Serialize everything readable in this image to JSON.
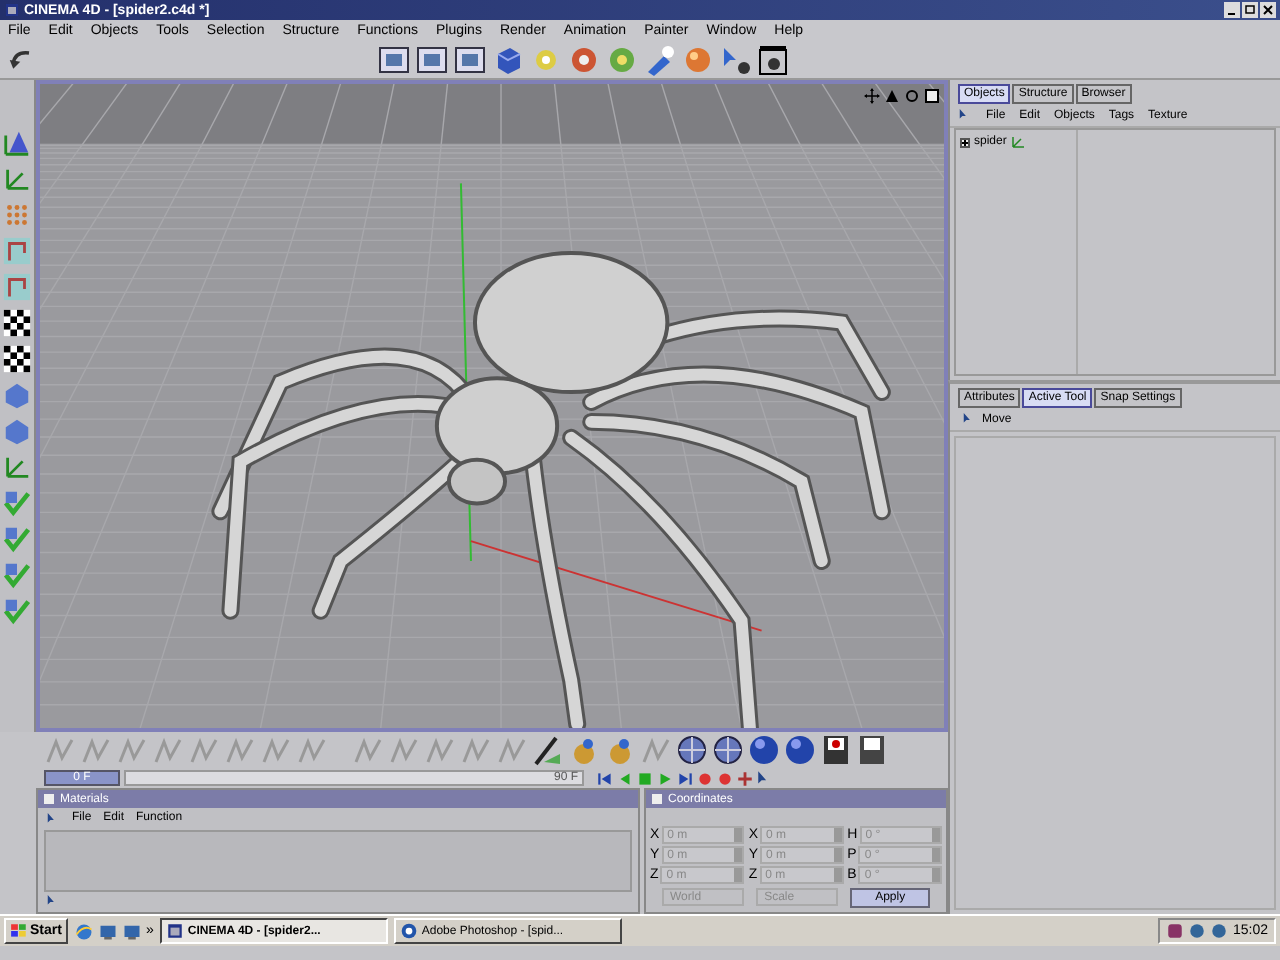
{
  "window": {
    "title": "CINEMA 4D - [spider2.c4d *]"
  },
  "menu": [
    "File",
    "Edit",
    "Objects",
    "Tools",
    "Selection",
    "Structure",
    "Functions",
    "Plugins",
    "Render",
    "Animation",
    "Painter",
    "Window",
    "Help"
  ],
  "object_manager": {
    "tabs": [
      {
        "label": "Objects",
        "selected": true
      },
      {
        "label": "Structure",
        "selected": false
      },
      {
        "label": "Browser",
        "selected": false
      }
    ],
    "menu": [
      "File",
      "Edit",
      "Objects",
      "Tags",
      "Texture"
    ],
    "objects": [
      {
        "name": "spider",
        "expanded": false
      }
    ]
  },
  "attribute_manager": {
    "tabs": [
      {
        "label": "Attributes",
        "selected": false
      },
      {
        "label": "Active Tool",
        "selected": true
      },
      {
        "label": "Snap Settings",
        "selected": false
      }
    ],
    "tool": "Move"
  },
  "timeline": {
    "start": "0 F",
    "end": "90 F"
  },
  "materials": {
    "title": "Materials",
    "menu": [
      "File",
      "Edit",
      "Function"
    ]
  },
  "coordinates": {
    "title": "Coordinates",
    "columns": [
      [
        {
          "axis": "X",
          "value": "0 m"
        },
        {
          "axis": "Y",
          "value": "0 m"
        },
        {
          "axis": "Z",
          "value": "0 m"
        }
      ],
      [
        {
          "axis": "X",
          "value": "0 m"
        },
        {
          "axis": "Y",
          "value": "0 m"
        },
        {
          "axis": "Z",
          "value": "0 m"
        }
      ],
      [
        {
          "axis": "H",
          "value": "0 °"
        },
        {
          "axis": "P",
          "value": "0 °"
        },
        {
          "axis": "B",
          "value": "0 °"
        }
      ]
    ],
    "dropdowns": [
      "World",
      "Scale"
    ],
    "apply": "Apply"
  },
  "taskbar": {
    "start": "Start",
    "quick_launch_more": "»",
    "tasks": [
      {
        "label": "CINEMA 4D - [spider2...",
        "selected": true
      },
      {
        "label": "Adobe Photoshop - [spid...",
        "selected": false
      }
    ],
    "clock": "15:02"
  }
}
